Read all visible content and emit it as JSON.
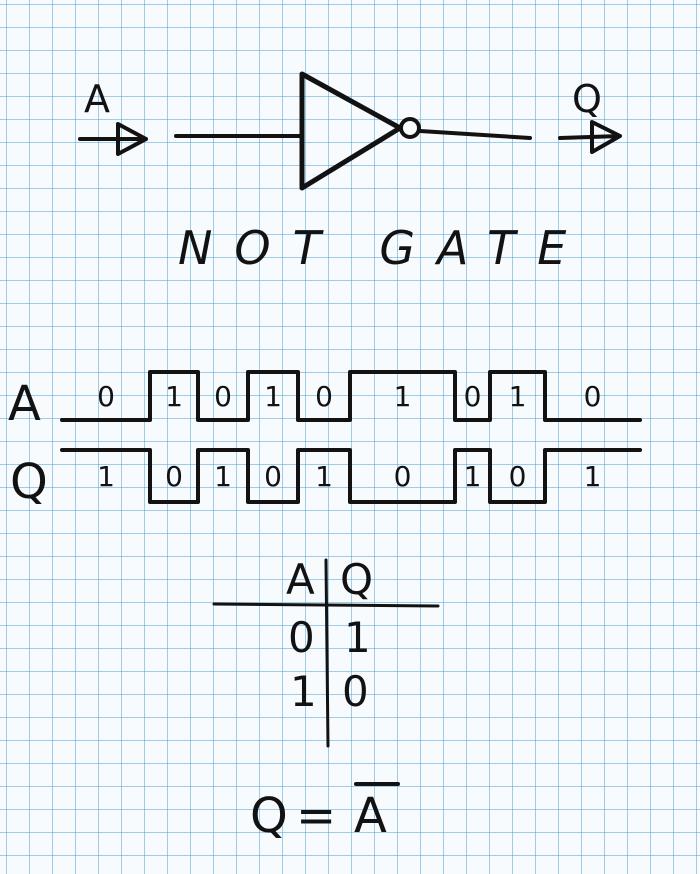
{
  "gate": {
    "input_label": "A",
    "output_label": "Q",
    "title": "NOT GATE"
  },
  "waveform": {
    "a_label": "A",
    "q_label": "Q",
    "a_bits": [
      "0",
      "1",
      "0",
      "1",
      "0",
      "1",
      "0",
      "1",
      "0"
    ],
    "q_bits": [
      "1",
      "0",
      "1",
      "0",
      "1",
      "0",
      "1",
      "0",
      "1"
    ]
  },
  "truth_table": {
    "headers": [
      "A",
      "Q"
    ],
    "rows": [
      [
        "0",
        "1"
      ],
      [
        "1",
        "0"
      ]
    ]
  },
  "equation": {
    "lhs": "Q",
    "equals": "=",
    "rhs": "A"
  },
  "colors": {
    "ink": "#121212",
    "grid": "#5aa5d7",
    "paper": "#f7fbfd"
  }
}
